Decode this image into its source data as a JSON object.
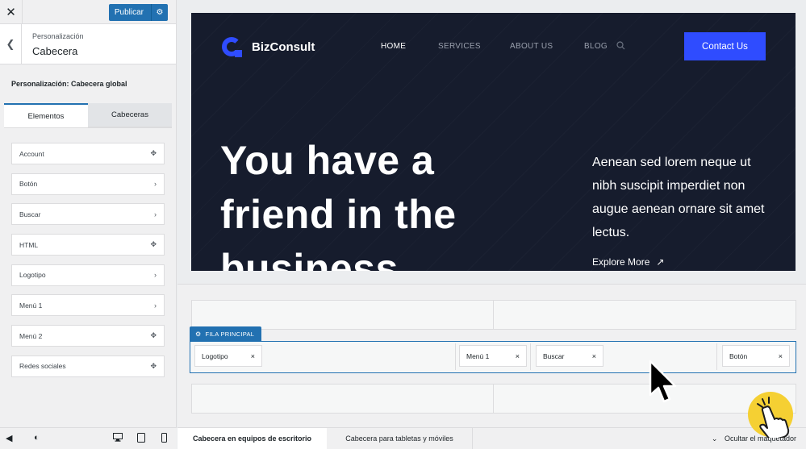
{
  "sidebar": {
    "close_icon": "close-icon",
    "publish_label": "Publicar",
    "publish_settings_icon": "gear-icon",
    "back_icon": "chevron-left-icon",
    "breadcrumb": "Personalización",
    "section_title": "Cabecera",
    "panel_description": "Personalización: Cabecera global",
    "tabs": [
      {
        "label": "Elementos",
        "active": true
      },
      {
        "label": "Cabeceras",
        "active": false
      }
    ],
    "elements": [
      {
        "label": "Account",
        "icon": "move-icon"
      },
      {
        "label": "Botón",
        "icon": "chevron-right-icon"
      },
      {
        "label": "Buscar",
        "icon": "chevron-right-icon"
      },
      {
        "label": "HTML",
        "icon": "move-icon"
      },
      {
        "label": "Logotipo",
        "icon": "chevron-right-icon"
      },
      {
        "label": "Menú 1",
        "icon": "chevron-right-icon"
      },
      {
        "label": "Menú 2",
        "icon": "move-icon"
      },
      {
        "label": "Redes sociales",
        "icon": "move-icon"
      }
    ],
    "footer_icons": [
      "collapse-icon",
      "dark-mode-icon",
      "desktop-icon",
      "tablet-icon",
      "mobile-icon"
    ]
  },
  "preview": {
    "brand": "BizConsult",
    "nav": [
      "HOME",
      "SERVICES",
      "ABOUT US",
      "BLOG"
    ],
    "active_nav": "HOME",
    "contact_button": "Contact Us",
    "hero_title_lines": [
      "You have a",
      "friend in the",
      "business"
    ],
    "hero_text": "Aenean sed lorem neque ut nibh suscipit imperdiet non augue aenean ornare sit amet lectus.",
    "explore_link": "Explore More",
    "colors": {
      "background": "#161c2d",
      "accent": "#2f4cff"
    }
  },
  "builder": {
    "row_label": "FILA PRINCIPAL",
    "chips": [
      {
        "label": "Logotipo"
      },
      {
        "label": "Menú 1"
      },
      {
        "label": "Buscar"
      },
      {
        "label": "Botón"
      }
    ],
    "remove_glyph": "×"
  },
  "bottom_bar": {
    "tabs": [
      {
        "label": "Cabecera en equipos de escritorio",
        "active": true
      },
      {
        "label": "Cabecera para tabletas y móviles",
        "active": false
      }
    ],
    "hide_builder": "Ocultar el maquetador"
  }
}
